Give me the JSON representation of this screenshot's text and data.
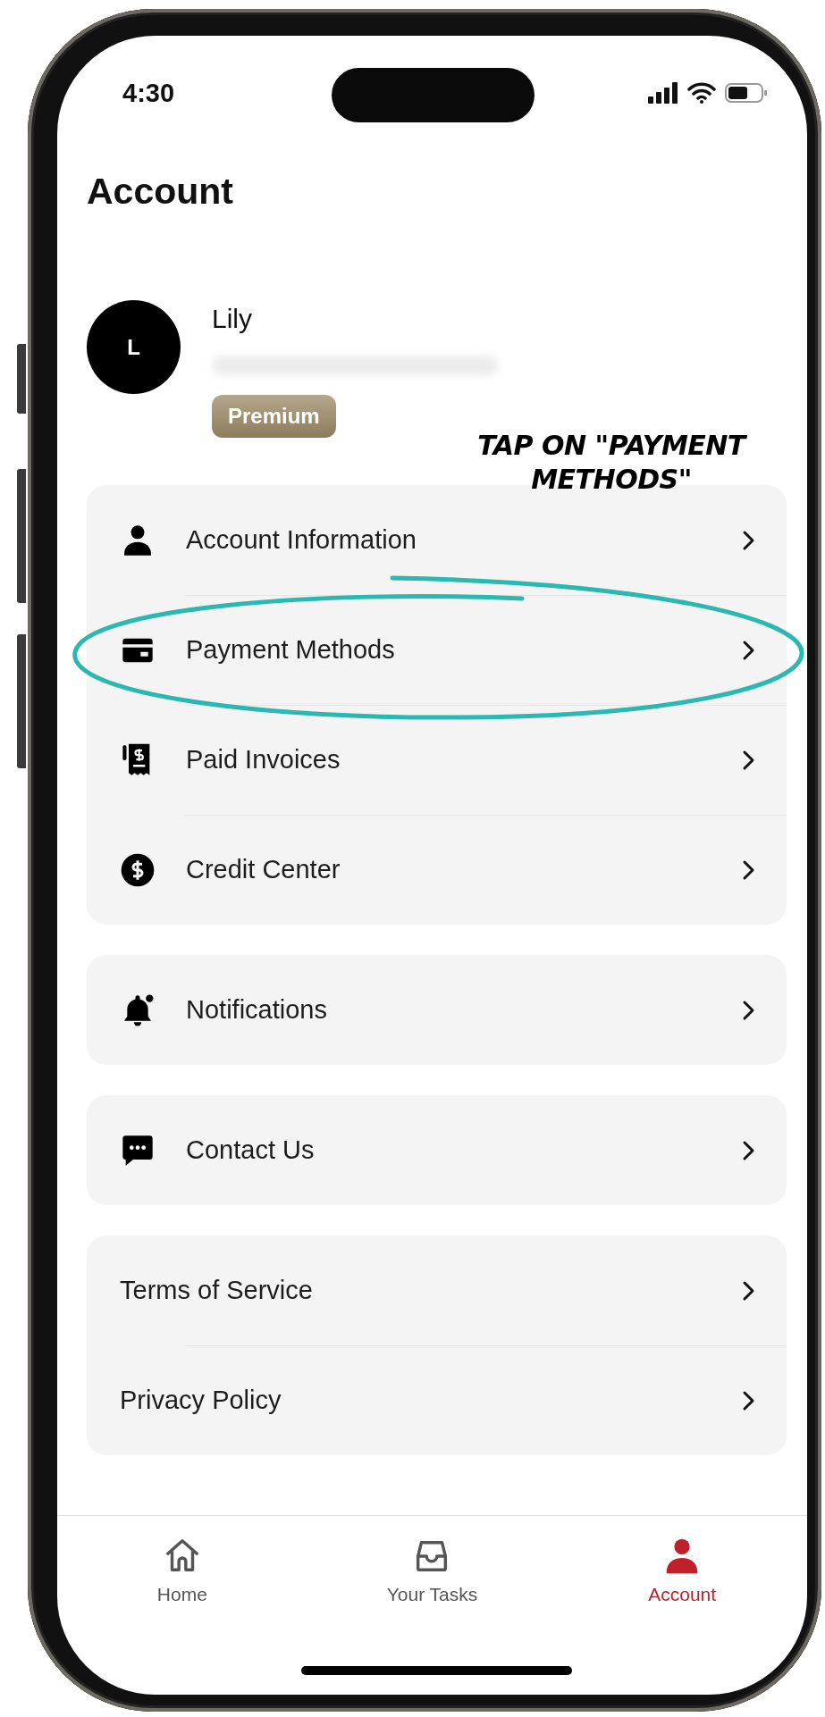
{
  "status_bar": {
    "time": "4:30"
  },
  "header": {
    "title": "Account"
  },
  "profile": {
    "avatar_initial": "L",
    "name": "Lily",
    "badge": "Premium"
  },
  "annotation": {
    "lines": [
      "TAP ON \"PAYMENT",
      "METHODS\""
    ]
  },
  "menu_groups": [
    {
      "items": [
        {
          "label": "Account Information"
        },
        {
          "label": "Payment Methods"
        },
        {
          "label": "Paid Invoices"
        },
        {
          "label": "Credit Center"
        }
      ]
    },
    {
      "items": [
        {
          "label": "Notifications"
        }
      ]
    },
    {
      "items": [
        {
          "label": "Contact Us"
        }
      ]
    },
    {
      "items": [
        {
          "label": "Terms of Service"
        },
        {
          "label": "Privacy Policy"
        }
      ]
    }
  ],
  "tab_bar": {
    "items": [
      {
        "label": "Home",
        "selected": false
      },
      {
        "label": "Your Tasks",
        "selected": false
      },
      {
        "label": "Account",
        "selected": true
      }
    ]
  }
}
